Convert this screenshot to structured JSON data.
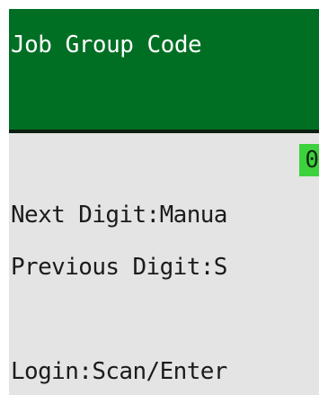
{
  "header": {
    "title": "Job Group Code"
  },
  "entry": {
    "value": "0"
  },
  "hints": {
    "next_digit": "Next Digit:Manua",
    "previous_digit": "Previous Digit:S",
    "login": "Login:Scan/Enter"
  },
  "colors": {
    "header_bg": "#006f24",
    "screen_bg": "#e4e4e4",
    "entry_highlight": "#3ed13e"
  }
}
